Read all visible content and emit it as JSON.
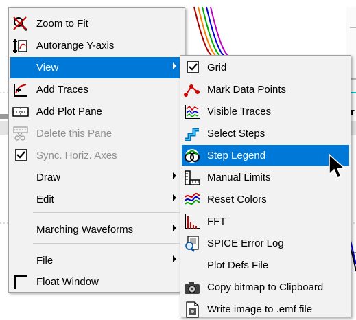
{
  "colors": {
    "highlight": "#0078d7",
    "menu_bg": "#f2f2f2",
    "disabled_text": "#8f8f8f"
  },
  "main_menu": [
    {
      "label": "Zoom to Fit",
      "icon": "zoom-fit-icon"
    },
    {
      "label": "Autorange Y-axis",
      "icon": "autorange-icon"
    },
    {
      "label": "View",
      "icon": "",
      "submenu": true,
      "highlighted": true
    },
    {
      "label": "Add Traces",
      "icon": "add-traces-icon"
    },
    {
      "label": "Add Plot Pane",
      "icon": "add-pane-icon"
    },
    {
      "label": "Delete this Pane",
      "icon": "delete-pane-icon",
      "disabled": true
    },
    {
      "label": "Sync. Horiz. Axes",
      "icon": "checkbox-icon",
      "checked": true,
      "disabled": true
    },
    {
      "label": "Draw",
      "icon": "",
      "submenu": true
    },
    {
      "label": "Edit",
      "icon": "",
      "submenu": true
    },
    {
      "label": "Marching Waveforms",
      "icon": "",
      "submenu": true
    },
    {
      "label": "File",
      "icon": "",
      "submenu": true
    },
    {
      "label": "Float Window",
      "icon": "float-window-icon"
    }
  ],
  "view_submenu": [
    {
      "label": "Grid",
      "icon": "checkbox-icon",
      "checked": true
    },
    {
      "label": "Mark Data Points",
      "icon": "mark-points-icon"
    },
    {
      "label": "Visible Traces",
      "icon": "visible-traces-icon"
    },
    {
      "label": "Select Steps",
      "icon": "select-steps-icon"
    },
    {
      "label": "Step Legend",
      "icon": "step-legend-icon",
      "highlighted": true
    },
    {
      "label": "Manual Limits",
      "icon": "manual-limits-icon"
    },
    {
      "label": "Reset Colors",
      "icon": "reset-colors-icon"
    },
    {
      "label": "FFT",
      "icon": "fft-icon"
    },
    {
      "label": "SPICE Error Log",
      "icon": "error-log-icon"
    },
    {
      "label": "Plot Defs File",
      "icon": ""
    },
    {
      "label": "Copy bitmap to Clipboard",
      "icon": "camera-icon"
    },
    {
      "label": "Write image to .emf file",
      "icon": "emf-file-icon"
    }
  ]
}
